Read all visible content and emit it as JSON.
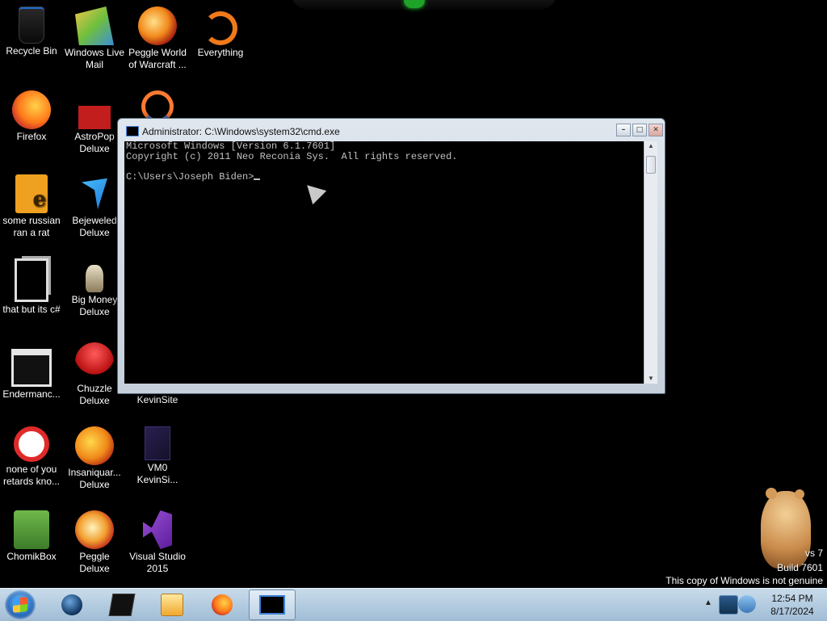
{
  "desktop": {
    "icons": [
      {
        "label": "Recycle Bin",
        "icon": "recycle-bin-icon"
      },
      {
        "label": "Windows Live Mail",
        "icon": "mail-icon"
      },
      {
        "label": "Peggle World of Warcraft ...",
        "icon": "peggle-icon"
      },
      {
        "label": "Everything",
        "icon": "everything-icon"
      },
      {
        "label": "Firefox",
        "icon": "firefox-icon"
      },
      {
        "label": "AstroPop Deluxe",
        "icon": "astropop-icon"
      },
      {
        "label": "some russian ran a rat",
        "icon": "rat-icon"
      },
      {
        "label": "Bejeweled Deluxe",
        "icon": "bejeweled-icon"
      },
      {
        "label": "that but its c#",
        "icon": "csharp-icon"
      },
      {
        "label": "Big Money Deluxe",
        "icon": "big-money-icon"
      },
      {
        "label": "Endermanc...",
        "icon": "enderman-icon"
      },
      {
        "label": "Chuzzle Deluxe",
        "icon": "chuzzle-icon"
      },
      {
        "label": "KevinSite",
        "icon": "kevinsite-icon"
      },
      {
        "label": "none of you retards kno...",
        "icon": "shortcut-icon"
      },
      {
        "label": "Insaniquar... Deluxe",
        "icon": "insaniquarium-icon"
      },
      {
        "label": "VM0 KevinSi...",
        "icon": "vm0-icon"
      },
      {
        "label": "ChomikBox",
        "icon": "chomikbox-icon"
      },
      {
        "label": "Peggle Deluxe",
        "icon": "peggle-deluxe-icon"
      },
      {
        "label": "Visual Studio 2015",
        "icon": "visual-studio-icon"
      }
    ]
  },
  "cmd_window": {
    "title": "Administrator: C:\\Windows\\system32\\cmd.exe",
    "lines": [
      "Microsoft Windows [Version 6.1.7601]",
      "Copyright (c) 2011 Neo Reconia Sys.  All rights reserved.",
      "",
      "C:\\Users\\Joseph Biden>"
    ],
    "controls": {
      "minimize": "–",
      "maximize": "□",
      "close": "✕"
    }
  },
  "watermark": {
    "line1": "vs 7",
    "line2": "Build 7601",
    "line3": "This copy of Windows is not genuine"
  },
  "taskbar": {
    "start_icon": "windows-start-icon",
    "pinned": [
      "globe-icon",
      "terminal-icon",
      "media-player-icon",
      "firefox-icon",
      "cmd-icon"
    ],
    "tray": {
      "expand_arrow": "▲",
      "icons": [
        "network-icon",
        "security-icon"
      ]
    },
    "clock": {
      "time": "12:54 PM",
      "date": "8/17/2024"
    }
  },
  "colors": {
    "desktop": "#000000",
    "taskbar": "#a9c4db",
    "console_text": "#c0c0c0"
  }
}
